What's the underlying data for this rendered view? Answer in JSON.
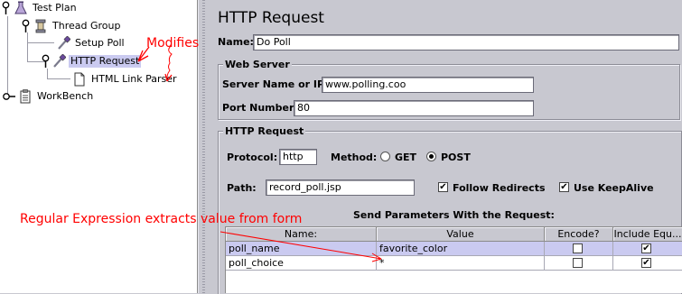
{
  "tree": {
    "test_plan": "Test Plan",
    "thread_group": "Thread Group",
    "setup_poll": "Setup Poll",
    "http_request": "HTTP Request",
    "html_link_parser": "HTML Link Parser",
    "workbench": "WorkBench"
  },
  "annotations": {
    "modifies": "Modifies",
    "regex": "Regular Expression extracts value from form"
  },
  "panel": {
    "title": "HTTP Request",
    "name_label": "Name:",
    "name_value": "Do Poll",
    "web_server": {
      "title": "Web Server",
      "server_label": "Server Name or IP:",
      "server_value": "www.polling.coo",
      "port_label": "Port Number:",
      "port_value": "80"
    },
    "http_request": {
      "title": "HTTP Request",
      "protocol_label": "Protocol:",
      "protocol_value": "http",
      "method_label": "Method:",
      "get_label": "GET",
      "post_label": "POST",
      "method_selected": "POST",
      "path_label": "Path:",
      "path_value": "record_poll.jsp",
      "follow_redirects_label": "Follow Redirects",
      "follow_redirects": true,
      "keepalive_label": "Use KeepAlive",
      "keepalive": true
    },
    "params": {
      "title": "Send Parameters With the Request:",
      "headers": [
        "Name:",
        "Value",
        "Encode?",
        "Include Equ..."
      ],
      "rows": [
        {
          "name": "poll_name",
          "value": "favorite_color",
          "encode": false,
          "include": true
        },
        {
          "name": "poll_choice",
          "value": "*",
          "encode": false,
          "include": true
        }
      ]
    }
  },
  "colors": {
    "panel_bg": "#c8c8d0",
    "selection": "#cacaf0",
    "annotation": "#ff0000"
  }
}
